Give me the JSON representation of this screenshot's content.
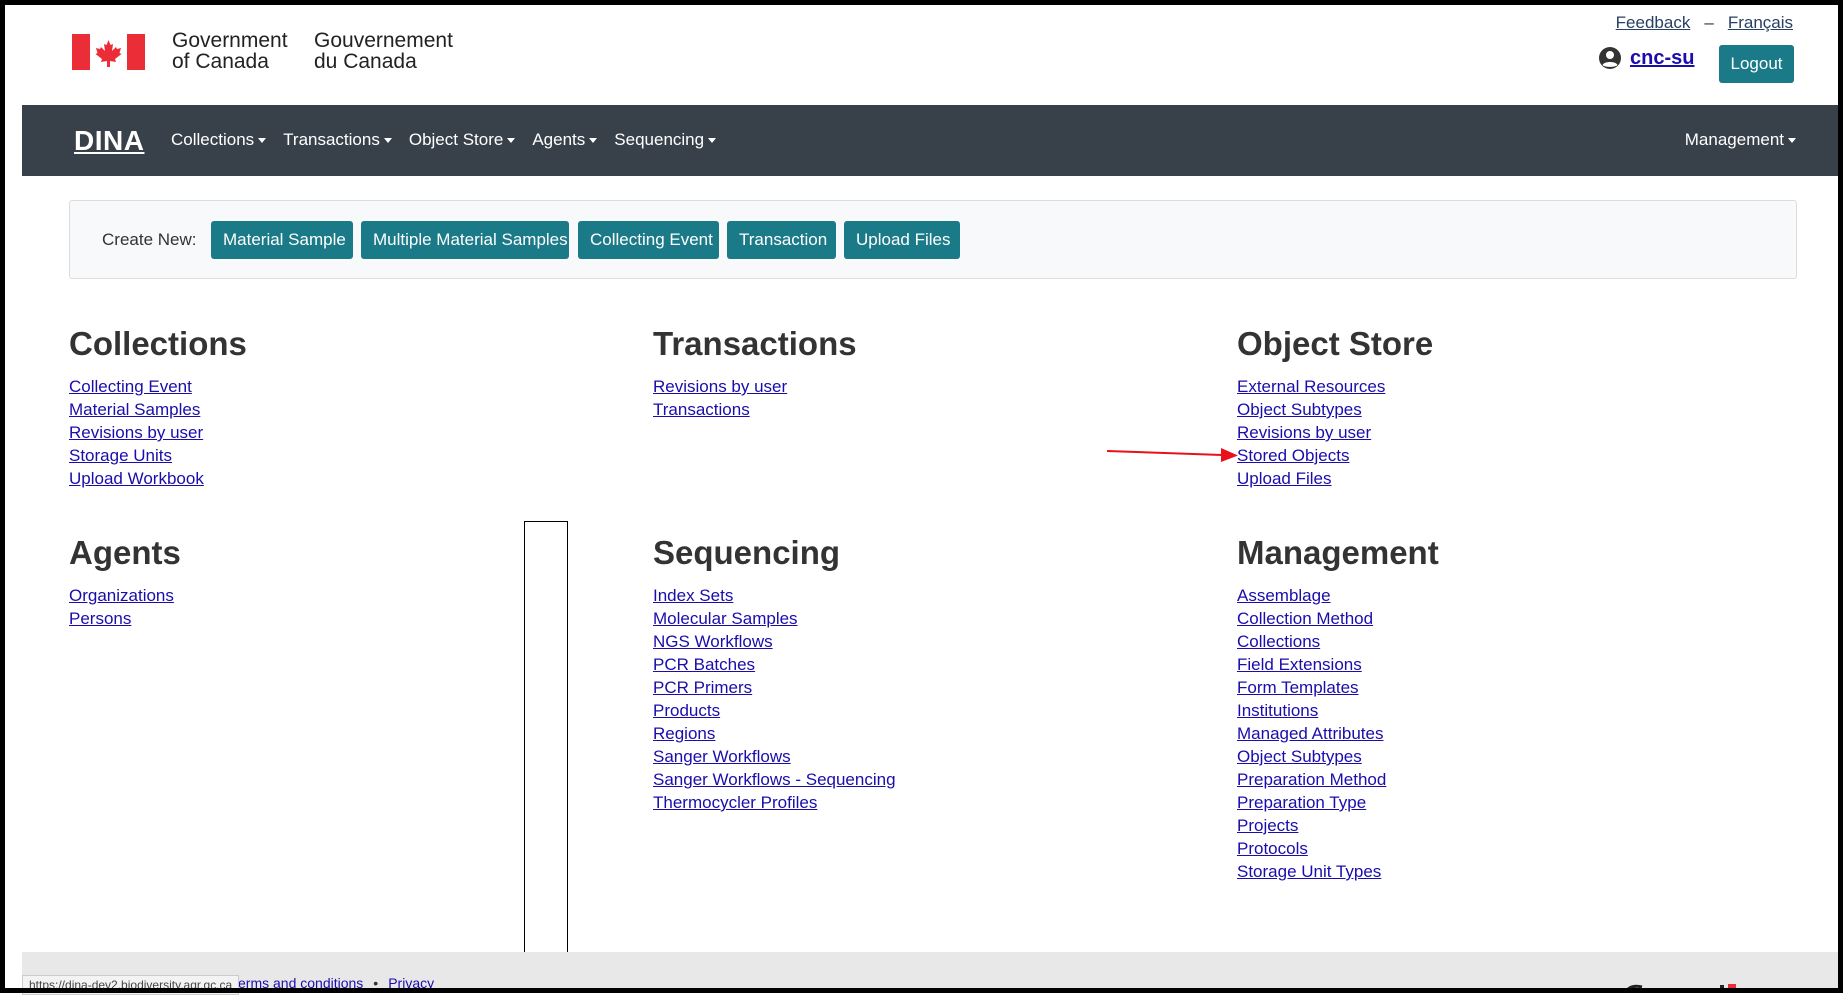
{
  "header": {
    "gov_en_line1": "Government",
    "gov_en_line2": "of Canada",
    "gov_fr_line1": "Gouvernement",
    "gov_fr_line2": "du Canada",
    "feedback": "Feedback",
    "separator": "–",
    "language": "Français",
    "username": "cnc-su",
    "logout": "Logout"
  },
  "navbar": {
    "brand": "DINA",
    "items": [
      {
        "label": "Collections"
      },
      {
        "label": "Transactions"
      },
      {
        "label": "Object Store"
      },
      {
        "label": "Agents"
      },
      {
        "label": "Sequencing"
      }
    ],
    "right": "Management"
  },
  "create_new": {
    "label": "Create New:",
    "buttons": [
      {
        "label": "Material Sample"
      },
      {
        "label": "Multiple Material Samples"
      },
      {
        "label": "Collecting Event"
      },
      {
        "label": "Transaction"
      },
      {
        "label": "Upload Files"
      }
    ]
  },
  "sections": {
    "collections": {
      "title": "Collections",
      "links": [
        "Collecting Event",
        "Material Samples",
        "Revisions by user",
        "Storage Units",
        "Upload Workbook"
      ]
    },
    "transactions": {
      "title": "Transactions",
      "links": [
        "Revisions by user",
        "Transactions"
      ]
    },
    "object_store": {
      "title": "Object Store",
      "links": [
        "External Resources",
        "Object Subtypes",
        "Revisions by user",
        "Stored Objects",
        "Upload Files"
      ]
    },
    "agents": {
      "title": "Agents",
      "links": [
        "Organizations",
        "Persons"
      ]
    },
    "sequencing": {
      "title": "Sequencing",
      "links": [
        "Index Sets",
        "Molecular Samples",
        "NGS Workflows",
        "PCR Batches",
        "PCR Primers",
        "Products",
        "Regions",
        "Sanger Workflows",
        "Sanger Workflows - Sequencing",
        "Thermocycler Profiles"
      ]
    },
    "management": {
      "title": "Management",
      "links": [
        "Assemblage",
        "Collection Method",
        "Collections",
        "Field Extensions",
        "Form Templates",
        "Institutions",
        "Managed Attributes",
        "Object Subtypes",
        "Preparation Method",
        "Preparation Type",
        "Projects",
        "Protocols",
        "Storage Unit Types"
      ]
    }
  },
  "footer": {
    "status_url": "https://dina-dev2.biodiversity.agr.gc.ca",
    "terms": "erms and conditions",
    "bullet": "•",
    "privacy": "Privacy"
  },
  "colors": {
    "navbar_bg": "#38414a",
    "button_teal": "#1a7a88",
    "link": "#1a0dab",
    "canada_red": "#eb2d37",
    "annotation_arrow": "#e8101a"
  }
}
